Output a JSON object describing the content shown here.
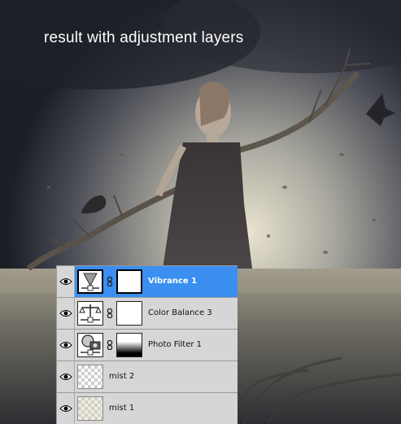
{
  "caption": "result with adjustment layers",
  "layers": [
    {
      "name": "Vibrance 1",
      "type": "vibrance",
      "selected": true,
      "has_mask": true,
      "mask": "white"
    },
    {
      "name": "Color Balance 3",
      "type": "color-balance",
      "selected": false,
      "has_mask": true,
      "mask": "white"
    },
    {
      "name": "Photo Filter 1",
      "type": "photo-filter",
      "selected": false,
      "has_mask": true,
      "mask": "gradient"
    },
    {
      "name": "mist 2",
      "type": "pixel",
      "selected": false,
      "has_mask": false
    },
    {
      "name": "mist 1",
      "type": "pixel",
      "selected": false,
      "has_mask": false
    }
  ],
  "colors": {
    "selected_row": "#3a8ff0",
    "panel": "#d6d6d6"
  }
}
